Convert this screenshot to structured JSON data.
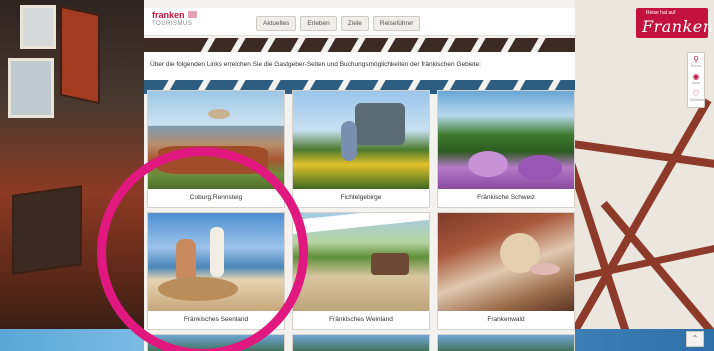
{
  "header": {
    "logo_line1": "franken",
    "logo_line2": "TOURISMUS",
    "nav": [
      "Aktuelles",
      "Erleben",
      "Ziele",
      "Reiseführer"
    ]
  },
  "intro_text": "Über die folgenden Links erreichen Sie die Gastgeber-Seiten und Buchungsmöglichkeiten der fränkischen Gebiete:",
  "regions": [
    {
      "label": "Coburg.Rennsteig"
    },
    {
      "label": "Fichtelgebirge"
    },
    {
      "label": "Fränkische Schweiz"
    },
    {
      "label": "Fränkisches Seenland"
    },
    {
      "label": "Fränkisches Weinland"
    },
    {
      "label": "Frankenwald"
    }
  ],
  "brand": {
    "tagline": "Reise hat auf",
    "name": "Franken"
  },
  "side_tools": [
    {
      "icon": "search-icon",
      "label": "Suche"
    },
    {
      "icon": "location-pin-icon",
      "label": "Karte"
    },
    {
      "icon": "heart-icon",
      "label": "Merkliste"
    }
  ],
  "colors": {
    "brand": "#c4123e",
    "highlight": "#e0187f"
  }
}
